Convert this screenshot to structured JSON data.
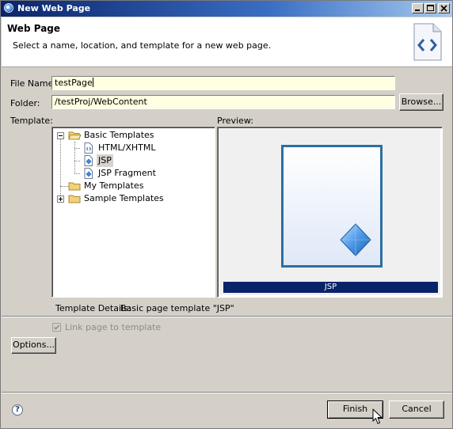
{
  "window": {
    "title": "New Web Page"
  },
  "header": {
    "title": "Web Page",
    "subtitle": "Select a name, location, and template for a new web page."
  },
  "form": {
    "file_name_label": "File Name:",
    "file_name_value": "testPage",
    "folder_label": "Folder:",
    "folder_value": "/testProj/WebContent",
    "browse_label": "Browse..."
  },
  "template": {
    "label": "Template:",
    "tree": {
      "basic_templates": "Basic Templates",
      "html_xhtml": "HTML/XHTML",
      "jsp": "JSP",
      "jsp_fragment": "JSP Fragment",
      "my_templates": "My Templates",
      "sample_templates": "Sample Templates"
    },
    "selected": "JSP"
  },
  "preview": {
    "label": "Preview:",
    "caption": "JSP"
  },
  "details": {
    "label": "Template Details:",
    "value": "Basic page template \"JSP\""
  },
  "link_checkbox": {
    "label": "Link page to template",
    "checked": true,
    "enabled": false
  },
  "buttons": {
    "options": "Options...",
    "finish": "Finish",
    "cancel": "Cancel",
    "help": "?"
  }
}
